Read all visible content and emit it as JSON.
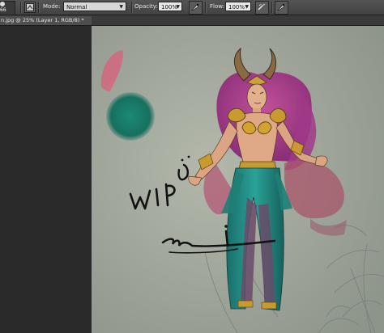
{
  "options_bar": {
    "brush_size": "66",
    "mode_label": "Mode:",
    "mode_value": "Normal",
    "opacity_label": "Opacity:",
    "opacity_value": "100%",
    "flow_label": "Flow:",
    "flow_value": "100%"
  },
  "document": {
    "tab_title": "n.jpg @ 25% (Layer 1, RGB/8) *"
  },
  "canvas_text": {
    "wip_scribble": "WIP",
    "signature": "dm"
  }
}
